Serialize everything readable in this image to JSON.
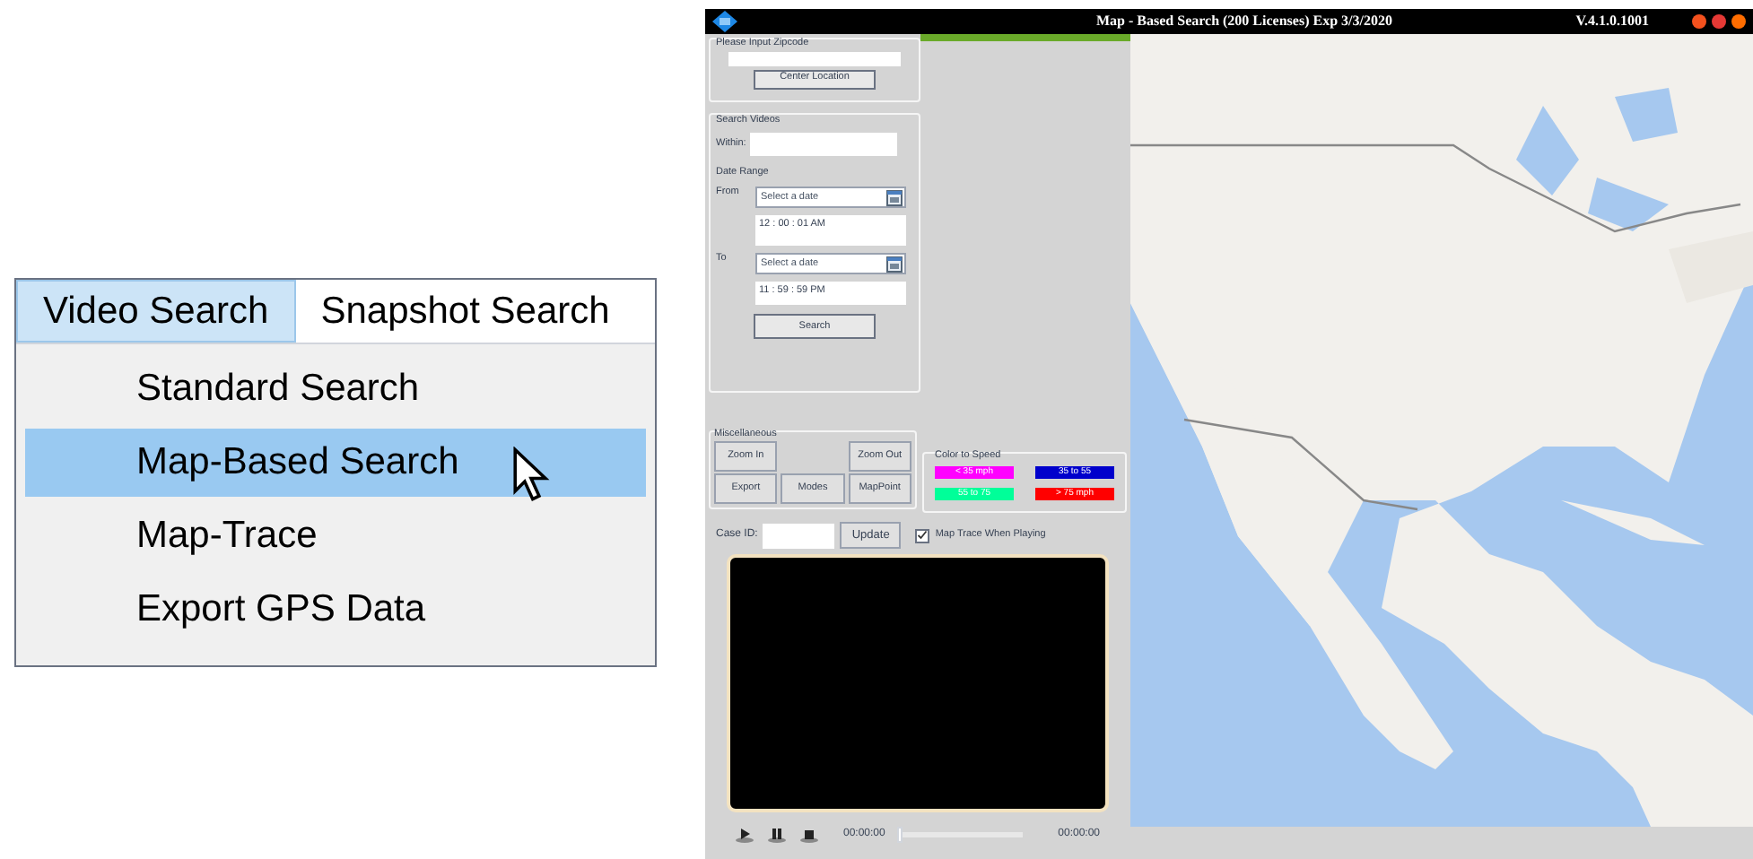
{
  "menu": {
    "tabs": [
      {
        "label": "Video Search",
        "selected": true
      },
      {
        "label": "Snapshot Search",
        "selected": false
      }
    ],
    "items": [
      {
        "label": "Standard Search",
        "selected": false
      },
      {
        "label": "Map-Based Search",
        "selected": true
      },
      {
        "label": "Map-Trace",
        "selected": false
      },
      {
        "label": "Export GPS Data",
        "selected": false
      }
    ]
  },
  "window": {
    "title": "Map - Based Search (200 Licenses) Exp 3/3/2020",
    "version": "V.4.1.0.1001",
    "progress": {
      "level": 1
    }
  },
  "zipcode": {
    "legend": "Please Input Zipcode",
    "button": "Center Location"
  },
  "search_videos": {
    "legend": "Search Videos",
    "within_label": "Within:",
    "date_range_label": "Date Range",
    "from_label": "From",
    "from_date": {
      "placeholder": "Select a date"
    },
    "from_time": "12 : 00 : 01 AM",
    "to_label": "To",
    "to_date": {
      "placeholder": "Select a date"
    },
    "to_time": "11 : 59 : 59 PM",
    "button": "Search"
  },
  "miscellaneous": {
    "legend": "Miscellaneous",
    "buttons": [
      "Zoom In",
      "Zoom Out",
      "Export",
      "Modes",
      "MapPoint"
    ]
  },
  "color_to_speed": {
    "legend": "Color to Speed",
    "items": [
      {
        "label": "< 35 mph",
        "color": "#ff00ff"
      },
      {
        "label": "35 to 55",
        "color": "#0000cc"
      },
      {
        "label": "55 to 75",
        "color": "#00ff99"
      },
      {
        "label": "> 75 mph",
        "color": "#ff0000"
      }
    ]
  },
  "case": {
    "label": "Case ID:",
    "button": "Update",
    "map_trace": {
      "label": "Map Trace When Playing",
      "checked": true
    }
  },
  "player": {
    "start_time": "00:00:00",
    "end_time": "00:00:00",
    "seek": {
      "level": 0
    }
  }
}
